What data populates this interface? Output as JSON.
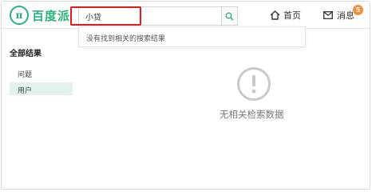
{
  "header": {
    "logo_mark": "π",
    "logo_text": "百度派",
    "search": {
      "value": "小贷",
      "placeholder": ""
    },
    "nav": {
      "home_label": "首页",
      "messages_label": "消息",
      "messages_badge": "5"
    }
  },
  "dropdown": {
    "no_result_text": "没有找到相关的搜索结果"
  },
  "sidebar": {
    "title": "全部结果",
    "items": [
      {
        "label": "问题",
        "selected": false
      },
      {
        "label": "用户",
        "selected": true
      }
    ]
  },
  "main": {
    "empty_text": "无相关检索数据"
  },
  "colors": {
    "brand": "#2ab27b",
    "highlight_border": "#e01b1b",
    "badge": "#f08f3c",
    "selected_bg": "#e3f2ec"
  }
}
